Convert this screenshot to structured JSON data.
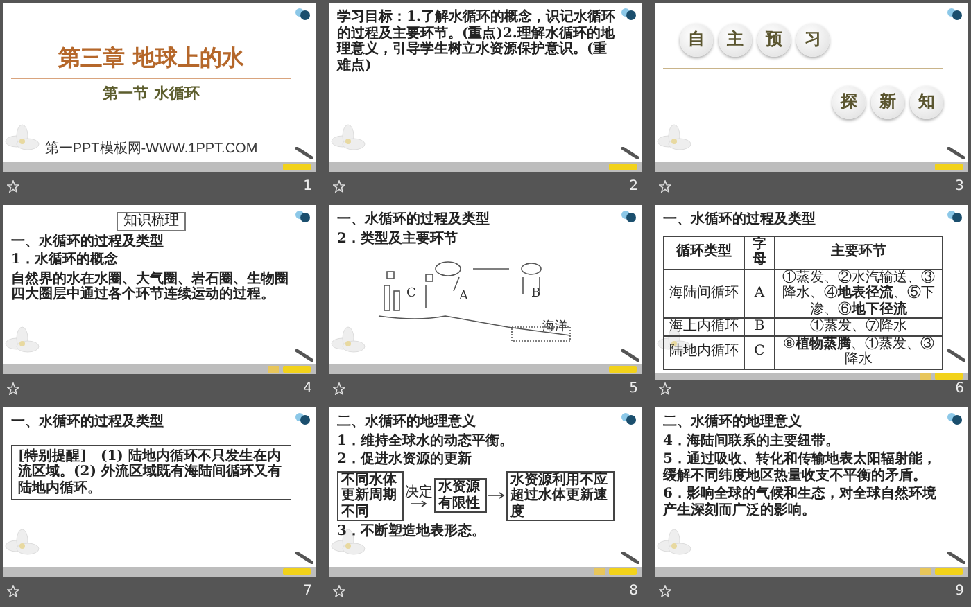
{
  "slides": [
    {
      "number": "1",
      "extra_button": false,
      "blocks": [
        {
          "kind": "title",
          "text": "第三章  地球上的水"
        },
        {
          "kind": "subtitle",
          "text": "第一节    水循环"
        },
        {
          "kind": "footer",
          "text": "第一PPT模板网-WWW.1PPT.COM"
        }
      ]
    },
    {
      "number": "2",
      "extra_button": false,
      "blocks": [
        {
          "kind": "para",
          "text": "学习目标：1.了解水循环的概念，识记水循环的过程及主要环节。(重点)2.理解水循环的地理意义，引导学生树立水资源保护意识。(重难点)"
        }
      ]
    },
    {
      "number": "3",
      "extra_button": false,
      "blocks": [
        {
          "kind": "circles",
          "chars": [
            "自",
            "主",
            "预",
            "习"
          ]
        },
        {
          "kind": "rule"
        },
        {
          "kind": "circles_right",
          "chars": [
            "探",
            "新",
            "知"
          ]
        }
      ]
    },
    {
      "number": "4",
      "extra_button": true,
      "blocks": [
        {
          "kind": "tag",
          "text": "知识梳理"
        },
        {
          "kind": "heading",
          "text": "一、水循环的过程及类型"
        },
        {
          "kind": "heading",
          "text": "1．水循环的概念"
        },
        {
          "kind": "para",
          "text": "**自然界**的水在水圈、**大气**圈、岩石圈、生物圈四大圈层中通过各个环节连续运动的过程。"
        }
      ]
    },
    {
      "number": "5",
      "extra_button": false,
      "blocks": [
        {
          "kind": "heading",
          "text": "一、水循环的过程及类型"
        },
        {
          "kind": "heading",
          "text": "2．类型及主要环节"
        },
        {
          "kind": "diagram",
          "labels": [
            "C",
            "A",
            "B",
            "海洋"
          ]
        }
      ]
    },
    {
      "number": "6",
      "extra_button": true,
      "blocks": [
        {
          "kind": "heading",
          "text": "一、水循环的过程及类型"
        },
        {
          "kind": "table",
          "columns": [
            "循环类型",
            "字母",
            "主要环节"
          ],
          "rows": [
            [
              "海陆间循环",
              "A",
              "①蒸发、②水汽输送、③降水、④**地表径流**、⑤下渗、⑥**地下径流**"
            ],
            [
              "海上内循环",
              "B",
              "①蒸发、⑦降水"
            ],
            [
              "陆地内循环",
              "C",
              "⑧**植物蒸腾**、①蒸发、③降水"
            ]
          ]
        }
      ]
    },
    {
      "number": "7",
      "extra_button": false,
      "blocks": [
        {
          "kind": "heading",
          "text": "一、水循环的过程及类型"
        },
        {
          "kind": "callout",
          "text": "**[特别提醒]**　(1) 陆地内循环不只发生在内流区域。(2) 外流区域既有海陆间循环又有陆地内循环。"
        }
      ]
    },
    {
      "number": "8",
      "extra_button": true,
      "blocks": [
        {
          "kind": "heading",
          "text": "二、水循环的地理意义"
        },
        {
          "kind": "para",
          "text": "1．维持全球水的**动态平衡**。"
        },
        {
          "kind": "para",
          "text": "2．促进水资源的更新"
        },
        {
          "kind": "flow",
          "connector": "决定",
          "boxes": [
            "不同水体**更新周期**不同",
            "水资源有限性",
            "水资源利用不应**超过**水体更新速度"
          ]
        },
        {
          "kind": "para",
          "text": "3．不断塑造**地表形态**。"
        }
      ]
    },
    {
      "number": "9",
      "extra_button": true,
      "blocks": [
        {
          "kind": "heading",
          "text": "二、水循环的地理意义"
        },
        {
          "kind": "para",
          "text": "4．**海陆间**联系的主要纽带。"
        },
        {
          "kind": "para",
          "text": "5．通过吸收、转化和传输地表**太阳辐射能**，缓解不同纬度地区**热量**收支不平衡的矛盾。"
        },
        {
          "kind": "para",
          "text": "6．影响全球的**气候**和**生态**，对全球自然环境产生深刻而广泛的影响。"
        }
      ]
    }
  ]
}
